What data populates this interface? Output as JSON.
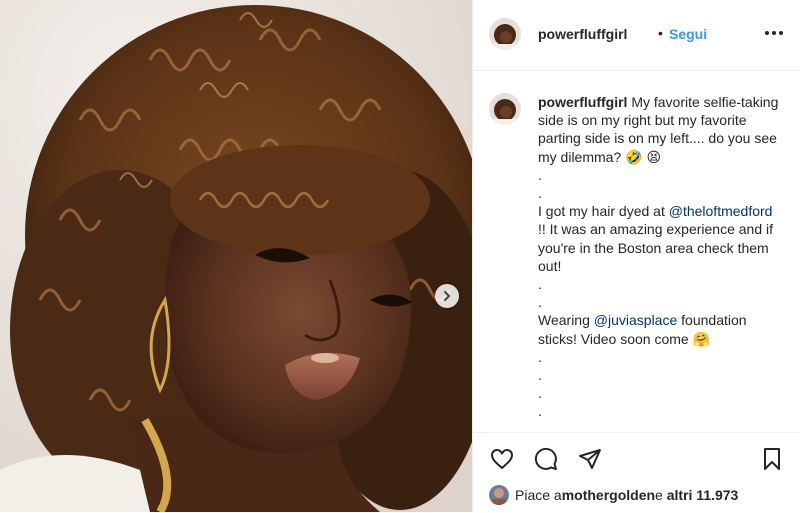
{
  "post": {
    "username": "powerfluffgirl",
    "separator": "•",
    "follow_label": "Segui",
    "more_icon": "more-horizontal-icon"
  },
  "caption": {
    "username": "powerfluffgirl",
    "line1": " My favorite selfie-taking side is on my right but my favorite parting side is on my left.... do you see my dilemma? ",
    "emoji1": "🤣",
    "emoji2": "😫",
    "dots1": ".\n.\n",
    "line2": "I got my hair dyed at ",
    "mention1": "@theloftmedford",
    "line3": " !! It was an amazing experience and if you're in the Boston area check them out!",
    "dots2": "\n.\n.\n",
    "line4": "Wearing ",
    "mention2": "@juviasplace",
    "line5": " foundation sticks! Video soon come ",
    "emoji3": "🤗",
    "dots3": "\n.\n.\n.\n.\n."
  },
  "actions": {
    "like_icon": "heart-icon",
    "comment_icon": "comment-icon",
    "share_icon": "send-icon",
    "save_icon": "bookmark-icon"
  },
  "likes": {
    "prefix": "Piace a ",
    "user": "mothergolden",
    "middle": " e ",
    "others": "altri 11.973"
  },
  "colors": {
    "accent": "#3897f0",
    "mention": "#00376b",
    "text": "#262626",
    "divider": "#efefef"
  }
}
